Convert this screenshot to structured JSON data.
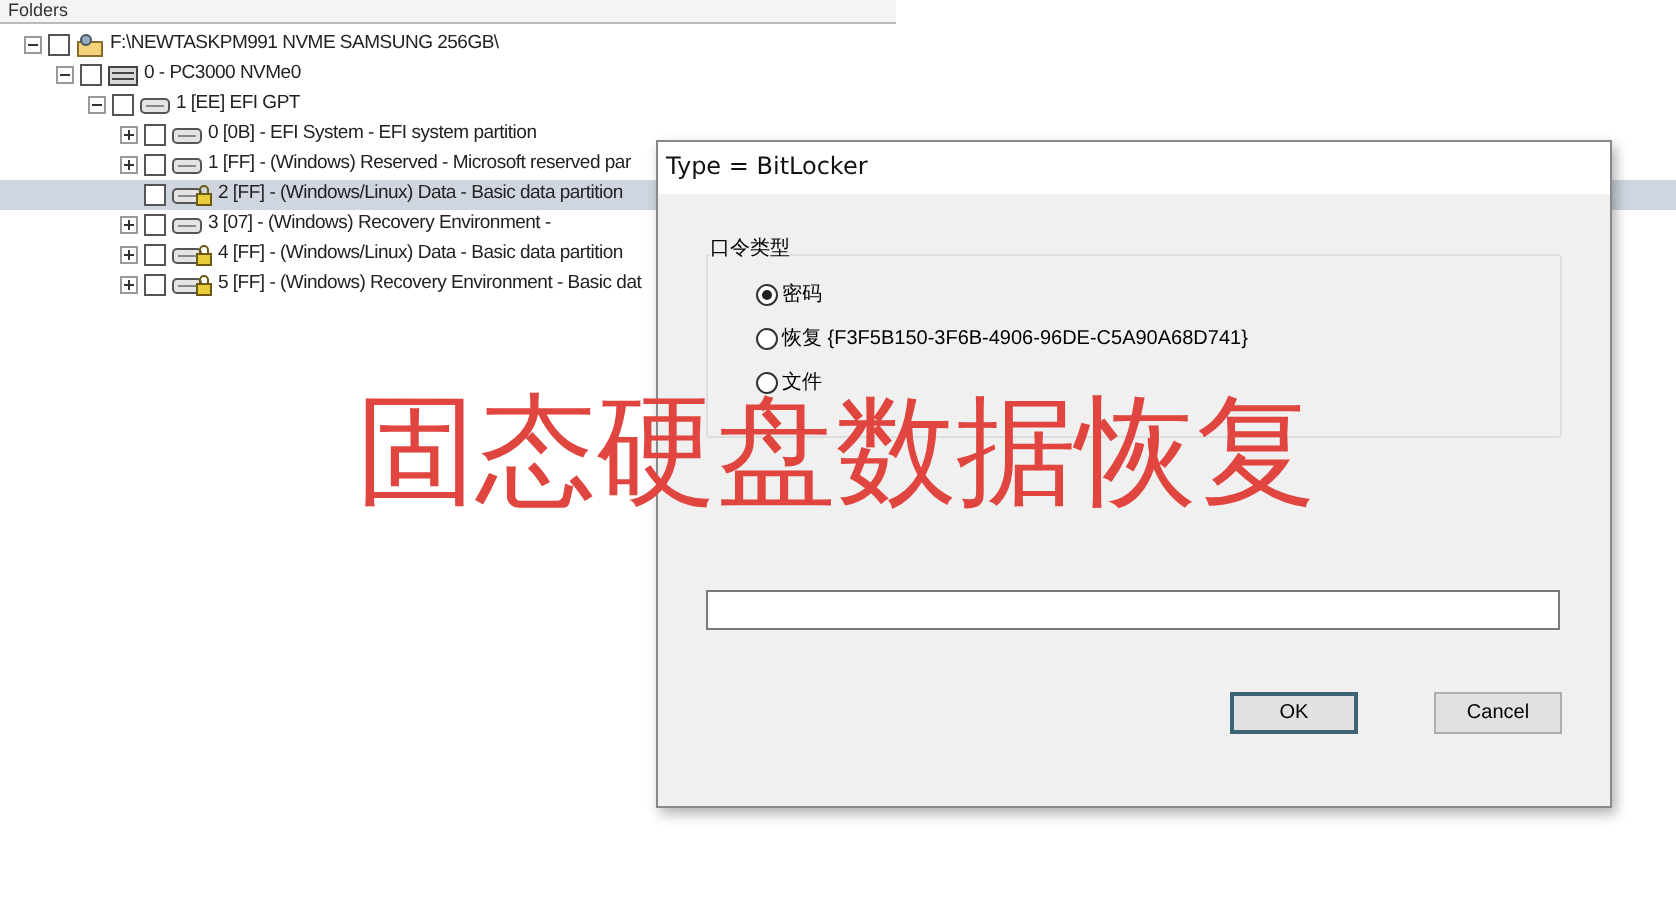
{
  "folders_header": {
    "title": "Folders"
  },
  "tree": [
    {
      "label": "F:\\NEWTASKPM991 NVME SAMSUNG 256GB\\",
      "kind": "drive",
      "expandable": true,
      "expanded": true,
      "checked": false,
      "locked": false,
      "selected": false,
      "children": [
        {
          "label": "0 - PC3000 NVMe0",
          "kind": "disk",
          "expandable": true,
          "expanded": true,
          "checked": false,
          "locked": false,
          "selected": false,
          "children": [
            {
              "label": "1 [EE] EFI GPT",
              "kind": "partition",
              "expandable": true,
              "expanded": true,
              "checked": false,
              "locked": false,
              "selected": false,
              "children": [
                {
                  "label": "0 [0B] - EFI System - EFI system partition",
                  "kind": "partition",
                  "expandable": true,
                  "expanded": false,
                  "checked": false,
                  "locked": false,
                  "selected": false
                },
                {
                  "label": "1 [FF] - (Windows) Reserved - Microsoft reserved par",
                  "kind": "partition",
                  "expandable": true,
                  "expanded": false,
                  "checked": false,
                  "locked": false,
                  "selected": false
                },
                {
                  "label": "2 [FF] - (Windows/Linux) Data - Basic data partition",
                  "kind": "partition",
                  "expandable": false,
                  "checked": false,
                  "locked": true,
                  "selected": true
                },
                {
                  "label": "3 [07] - (Windows) Recovery Environment -",
                  "kind": "partition",
                  "expandable": true,
                  "expanded": false,
                  "checked": false,
                  "locked": false,
                  "selected": false
                },
                {
                  "label": "4 [FF] - (Windows/Linux) Data - Basic data partition",
                  "kind": "partition",
                  "expandable": true,
                  "expanded": false,
                  "checked": false,
                  "locked": true,
                  "selected": false
                },
                {
                  "label": "5 [FF] - (Windows) Recovery Environment - Basic dat",
                  "kind": "partition",
                  "expandable": true,
                  "expanded": false,
                  "checked": false,
                  "locked": true,
                  "selected": false
                }
              ]
            }
          ]
        }
      ]
    }
  ],
  "dialog": {
    "title": "Type = BitLocker",
    "group_label": "口令类型",
    "options": [
      {
        "label": "密码",
        "selected": true
      },
      {
        "label": "恢复 {F3F5B150-3F6B-4906-96DE-C5A90A68D741}",
        "selected": false
      },
      {
        "label": "文件",
        "selected": false
      }
    ],
    "buttons": [
      {
        "label": "OK",
        "default": true
      },
      {
        "label": "Cancel",
        "default": false
      }
    ]
  },
  "overlay_caption": "固态硬盘数据恢复"
}
